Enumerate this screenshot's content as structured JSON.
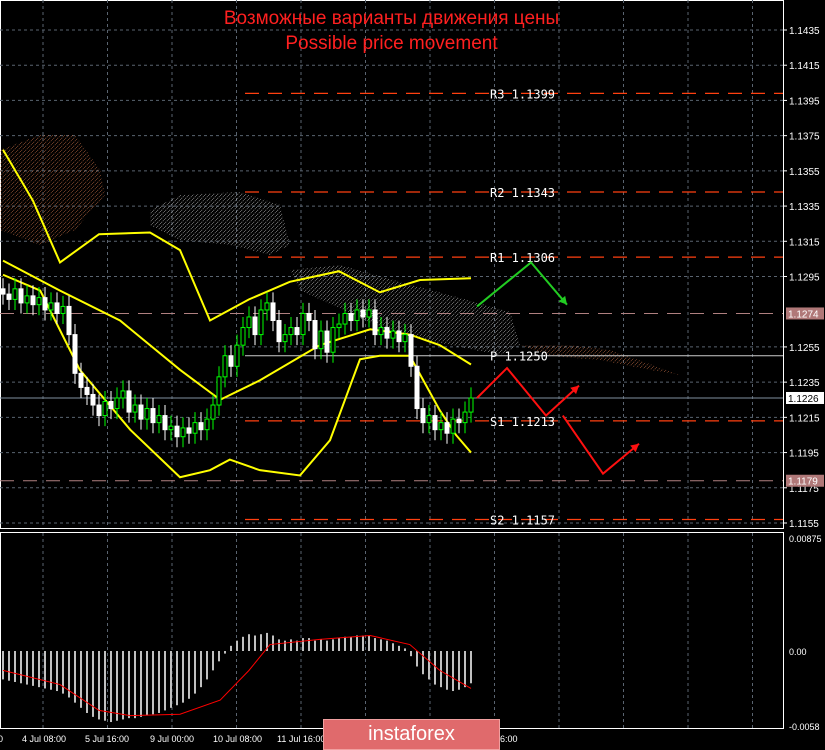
{
  "header": {
    "title_ru": "Возможные варианты движения цены",
    "title_en": "Possible price movement"
  },
  "logo": "instaforex",
  "colors": {
    "bull": "#00ff00",
    "bear": "#ffffff",
    "bollinger": "#ffff00",
    "pivot": "#ff4010",
    "macd_hist": "#c0c0c0",
    "macd_signal": "#ff0000",
    "arrow_up": "#22cc22",
    "arrow_down": "#ff1010"
  },
  "chart_data": [
    {
      "type": "candlestick",
      "title": "Possible price movement",
      "ylim": [
        1.115,
        1.145
      ],
      "y_ticks": [
        "1.1435",
        "1.1415",
        "1.1395",
        "1.1375",
        "1.1355",
        "1.1335",
        "1.1315",
        "1.1295",
        "1.1255",
        "1.1235",
        "1.1215",
        "1.1195",
        "1.1175",
        "1.1155"
      ],
      "price_markers": [
        {
          "label": "1.1274",
          "value": 1.1274,
          "style": "shaded"
        },
        {
          "label": "1.1226",
          "value": 1.1226,
          "style": "current"
        },
        {
          "label": "1.1179",
          "value": 1.1179,
          "style": "shaded"
        }
      ],
      "x_labels": [
        "0",
        "4 Jul 08:00",
        "5 Jul 16:00",
        "9 Jul 00:00",
        "10 Jul 08:00",
        "11 Jul 16:00",
        "6:00"
      ],
      "closes": [
        1.1285,
        1.1282,
        1.1288,
        1.128,
        1.1284,
        1.1279,
        1.1283,
        1.1276,
        1.128,
        1.1274,
        1.1278,
        1.1262,
        1.124,
        1.1232,
        1.1228,
        1.1222,
        1.1216,
        1.1224,
        1.122,
        1.1226,
        1.123,
        1.1218,
        1.1222,
        1.1214,
        1.122,
        1.1212,
        1.1216,
        1.1208,
        1.121,
        1.1204,
        1.1209,
        1.1206,
        1.1212,
        1.1208,
        1.1214,
        1.1222,
        1.1238,
        1.125,
        1.1244,
        1.1256,
        1.1266,
        1.1272,
        1.1262,
        1.1276,
        1.128,
        1.127,
        1.1258,
        1.1262,
        1.1266,
        1.1262,
        1.1274,
        1.127,
        1.1254,
        1.1264,
        1.1252,
        1.1266,
        1.1268,
        1.1274,
        1.127,
        1.1276,
        1.1272,
        1.1276,
        1.1262,
        1.1266,
        1.126,
        1.1264,
        1.1258,
        1.1262,
        1.1244,
        1.122,
        1.1212,
        1.1216,
        1.1208,
        1.1212,
        1.1206,
        1.1214,
        1.1212,
        1.1218,
        1.1226
      ],
      "pivots": [
        {
          "label": "R3  1.1399",
          "value": 1.1399
        },
        {
          "label": "R2  1.1343",
          "value": 1.1343
        },
        {
          "label": "R1  1.1306",
          "value": 1.1306
        },
        {
          "label": "P  1.1250",
          "value": 1.125
        },
        {
          "label": "S1  1.1213",
          "value": 1.1213
        },
        {
          "label": "S2  1.1157",
          "value": 1.1157
        }
      ],
      "bollinger": {
        "upper": [
          [
            0,
            1.1367
          ],
          [
            5,
            1.1338
          ],
          [
            9.5,
            1.1303
          ],
          [
            16,
            1.1319
          ],
          [
            24.5,
            1.132
          ],
          [
            29.5,
            1.131
          ],
          [
            34.5,
            1.127
          ],
          [
            41,
            1.1282
          ],
          [
            47.8,
            1.1292
          ],
          [
            56,
            1.1298
          ],
          [
            62.8,
            1.1286
          ],
          [
            69.5,
            1.1293
          ],
          [
            78,
            1.1294
          ]
        ],
        "middle": [
          [
            0,
            1.1304
          ],
          [
            9.5,
            1.1287
          ],
          [
            19.5,
            1.127
          ],
          [
            29.5,
            1.1242
          ],
          [
            36.2,
            1.1225
          ],
          [
            42.8,
            1.1236
          ],
          [
            52.8,
            1.1256
          ],
          [
            61.2,
            1.1265
          ],
          [
            67.8,
            1.1262
          ],
          [
            72.8,
            1.1256
          ],
          [
            78,
            1.1245
          ]
        ],
        "lower": [
          [
            0,
            1.1296
          ],
          [
            6.2,
            1.1287
          ],
          [
            12.8,
            1.1242
          ],
          [
            21.2,
            1.1208
          ],
          [
            29.5,
            1.1181
          ],
          [
            34.5,
            1.1185
          ],
          [
            37.8,
            1.1191
          ],
          [
            42.8,
            1.1185
          ],
          [
            49.5,
            1.1182
          ],
          [
            54.5,
            1.1202
          ],
          [
            59.5,
            1.1248
          ],
          [
            62.8,
            1.125
          ],
          [
            67.8,
            1.125
          ],
          [
            72.8,
            1.1219
          ],
          [
            75.5,
            1.1205
          ],
          [
            78,
            1.1195
          ]
        ]
      },
      "scenario_arrows": [
        {
          "direction": "up",
          "path": [
            [
              79,
              1.1278
            ],
            [
              88,
              1.1303
            ],
            [
              94,
              1.1279
            ]
          ]
        },
        {
          "direction": "down",
          "path": [
            [
              79,
              1.1226
            ],
            [
              84,
              1.1243
            ],
            [
              90.5,
              1.1216
            ],
            [
              96,
              1.1233
            ]
          ]
        },
        {
          "direction": "down",
          "path": [
            [
              93.3,
              1.1216
            ],
            [
              100,
              1.1183
            ],
            [
              106,
              1.12
            ]
          ]
        }
      ]
    },
    {
      "type": "bar",
      "title": "MACD",
      "ylim": [
        -0.0058,
        0.00875
      ],
      "y_ticks": [
        "0.00875",
        "0.00",
        "-0.0058"
      ],
      "histogram": [
        -0.0022,
        -0.0023,
        -0.0024,
        -0.0025,
        -0.0026,
        -0.0027,
        -0.0028,
        -0.0029,
        -0.003,
        -0.0031,
        -0.0033,
        -0.0036,
        -0.004,
        -0.0044,
        -0.0048,
        -0.0051,
        -0.0053,
        -0.0054,
        -0.0055,
        -0.0054,
        -0.0053,
        -0.0052,
        -0.0052,
        -0.0051,
        -0.005,
        -0.0049,
        -0.0048,
        -0.0046,
        -0.0044,
        -0.0042,
        -0.004,
        -0.0037,
        -0.0033,
        -0.0028,
        -0.0022,
        -0.0015,
        -0.0008,
        -0.0002,
        0.0004,
        0.0008,
        0.0011,
        0.0013,
        0.0012,
        0.0013,
        0.0014,
        0.0012,
        0.0009,
        0.0008,
        0.0009,
        0.0008,
        0.001,
        0.001,
        0.0008,
        0.0009,
        0.0008,
        0.0009,
        0.001,
        0.0011,
        0.0011,
        0.0012,
        0.0012,
        0.0012,
        0.001,
        0.0009,
        0.0008,
        0.0006,
        0.0004,
        0.0002,
        -0.0004,
        -0.0012,
        -0.0018,
        -0.0022,
        -0.0026,
        -0.0028,
        -0.003,
        -0.0031,
        -0.003,
        -0.0028,
        -0.0025
      ],
      "signal": [
        [
          0,
          -0.0015
        ],
        [
          9.5,
          -0.0026
        ],
        [
          16,
          -0.0046
        ],
        [
          21.2,
          -0.005
        ],
        [
          29.5,
          -0.0049
        ],
        [
          36.2,
          -0.0038
        ],
        [
          41,
          -0.0015
        ],
        [
          44.5,
          0.0005
        ],
        [
          52.8,
          0.0009
        ],
        [
          61.2,
          0.0012
        ],
        [
          67.8,
          0.0005
        ],
        [
          72.8,
          -0.0015
        ],
        [
          78,
          -0.0029
        ]
      ]
    }
  ]
}
